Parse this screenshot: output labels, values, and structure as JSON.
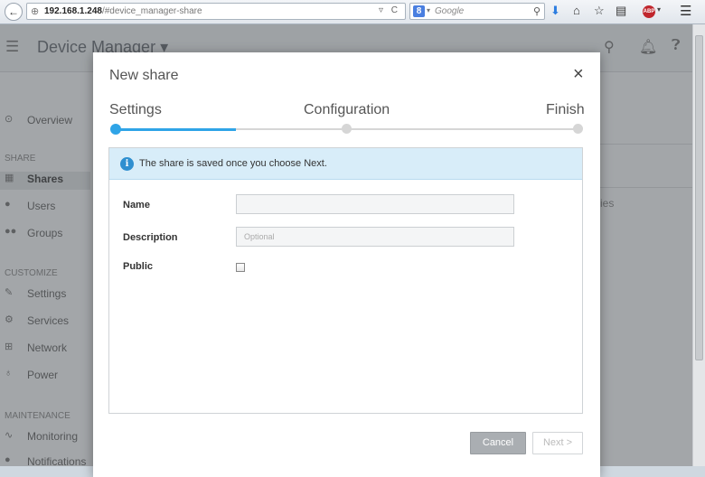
{
  "browser": {
    "back_glyph": "←",
    "url_host": "192.168.1.248",
    "url_path": "/#device_manager-share",
    "url_icons": "▿ C",
    "search_placeholder": "Google",
    "icons": [
      "globe-icon",
      "back-arrow-icon",
      "reload-icon",
      "google-icon",
      "search-icon",
      "download-icon",
      "home-icon",
      "bookmark-star-icon",
      "reading-list-icon",
      "adblock-icon",
      "menu-icon"
    ]
  },
  "app": {
    "title": "Device Manager ▾",
    "header_icons": [
      "search-icon",
      "bell-icon",
      "help-icon"
    ],
    "sidebar": {
      "overview": "Overview",
      "share_section": "SHARE",
      "shares": "Shares",
      "users": "Users",
      "groups": "Groups",
      "customize_section": "CUSTOMIZE",
      "settings": "Settings",
      "services": "Services",
      "network": "Network",
      "power": "Power",
      "maintenance_section": "MAINTENANCE",
      "monitoring": "Monitoring",
      "notifications": "Notifications"
    },
    "background_fragment": "ies"
  },
  "modal": {
    "title": "New share",
    "close_glyph": "×",
    "steps": [
      "Settings",
      "Configuration",
      "Finish"
    ],
    "current_step": 1,
    "progress_fraction": 0.26,
    "info_glyph": "i",
    "alert_text": "The share is saved once you choose Next.",
    "form": {
      "name_label": "Name",
      "name_value": "",
      "description_label": "Description",
      "description_placeholder": "Optional",
      "public_label": "Public",
      "public_checked": false
    },
    "buttons": {
      "cancel": "Cancel",
      "next": "Next >"
    }
  },
  "colors": {
    "accent": "#2fa4e7",
    "alert_bg": "#d8edf9",
    "cancel_bg": "#aaaeb2"
  }
}
